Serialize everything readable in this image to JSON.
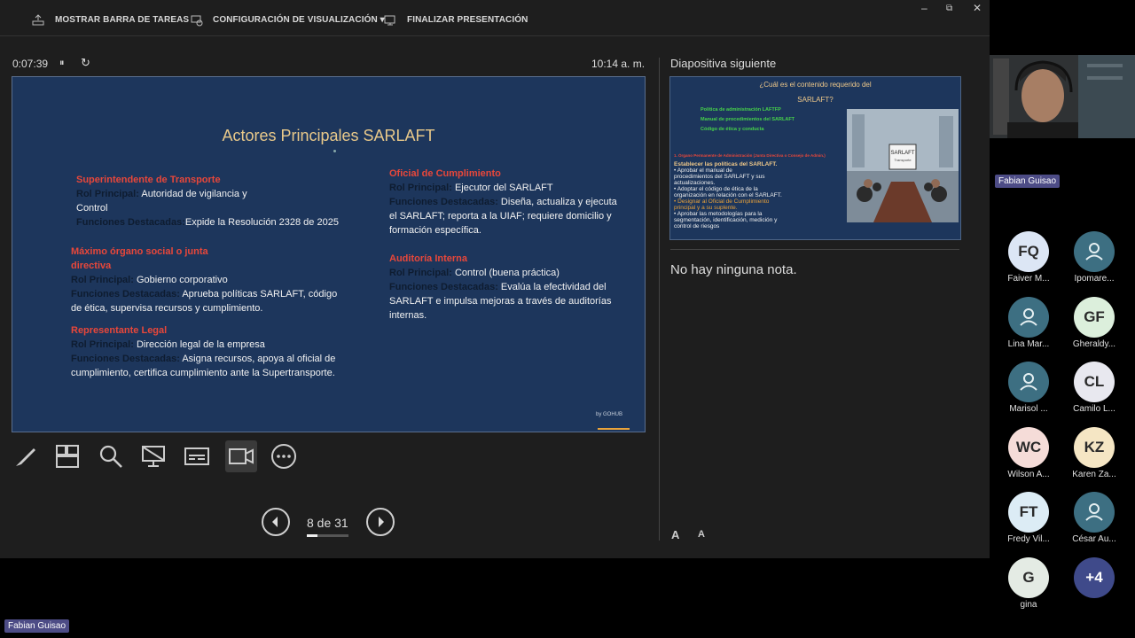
{
  "toolbar": {
    "show_taskbar": "MOSTRAR BARRA DE TAREAS",
    "display_settings": "CONFIGURACIÓN DE VISUALIZACIÓN ▾",
    "end_presentation": "FINALIZAR PRESENTACIÓN"
  },
  "window_controls": {
    "minimize": "–",
    "restore": "⧉",
    "close": "✕"
  },
  "timer": {
    "elapsed": "0:07:39",
    "pause": "⏸",
    "reset": "↻",
    "clock": "10:14 a. m."
  },
  "slide": {
    "title": "Actores Principales SARLAFT",
    "sections": [
      {
        "heading": "Superintendente de Transporte",
        "rol_label": "Rol Principal:",
        "rol_text_1": " Autoridad de vigilancia y",
        "rol_text_2": "Control",
        "fun_label": "Funciones Destacadas:",
        "fun_text_1": "Expide la Resolución 2328 de 2025"
      },
      {
        "heading_1": "Máximo órgano social o junta",
        "heading_2": "directiva",
        "rol_label": "Rol Principal:",
        "rol_text_1": " Gobierno corporativo",
        "fun_label": "Funciones Destacadas:",
        "fun_text_1": " Aprueba políticas SARLAFT, código",
        "fun_text_2": "de ética, supervisa recursos y cumplimiento."
      },
      {
        "heading": "Representante Legal",
        "rol_label": "Rol Principal:",
        "rol_text_1": " Dirección legal de la empresa",
        "fun_label": "Funciones Destacadas:",
        "fun_text_1": " Asigna recursos, apoya al oficial de",
        "fun_text_2": "cumplimiento, certifica cumplimiento ante la Supertransporte."
      },
      {
        "heading": "Oficial de Cumplimiento",
        "rol_label": "Rol Principal:",
        "rol_text_1": " Ejecutor del SARLAFT",
        "fun_label": "Funciones Destacadas:",
        "fun_text_1": " Diseña, actualiza y ejecuta",
        "fun_text_2": "el SARLAFT; reporta a la UIAF; requiere domicilio y",
        "fun_text_3": "formación específica."
      },
      {
        "heading": "Auditoría Interna",
        "rol_label": "Rol Principal:",
        "rol_text_1": " Control (buena práctica)",
        "fun_label": "Funciones Destacadas:",
        "fun_text_1": " Evalúa la efectividad del",
        "fun_text_2": "SARLAFT e impulsa mejoras a través de auditorías",
        "fun_text_3": "internas."
      }
    ],
    "logo": "by GOHUB"
  },
  "navigation": {
    "page": "8 de 31",
    "progress": 0.258
  },
  "next_slide": {
    "label": "Diapositiva siguiente",
    "title_1": "¿Cuál es el contenido requerido del",
    "title_2": "SARLAFT?",
    "bullets": [
      "Política de administración LAFTFP",
      "Manual de procedimientos del SARLAFT",
      "Código de ética y conducta"
    ],
    "org_heading": "1. Órgano Permanente de Administración (Junta Directiva o Consejo de Admin.)",
    "lines": [
      "Establecer las políticas del SARLAFT.",
      "• Aprobar el manual de",
      "procedimientos del SARLAFT y sus",
      "actualizaciones.",
      "• Adoptar el código de ética de la",
      "organización en relación con el SARLAFT.",
      "• Designar al Oficial de Cumplimiento",
      "principal y a su suplente.",
      "• Aprobar las metodologías para la",
      "segmentación, identificación, medición y",
      "control de riesgos"
    ],
    "image_sign": "SARLAFT",
    "image_sign_sub": "Transporte"
  },
  "notes": {
    "text": "No hay ninguna nota."
  },
  "font_controls": {
    "increase": "A",
    "decrease": "A"
  },
  "presenter_tag": "Fabian Guisao",
  "bottom_tag": "Fabian Guisao",
  "participants": [
    {
      "initials": "FQ",
      "name": "Faiver M...",
      "color": "#dce6f5"
    },
    {
      "initials": "",
      "name": "Ipomare...",
      "color": "#3d6f82",
      "icon": "person-icon"
    },
    {
      "initials": "",
      "name": "Lina Mar...",
      "color": "#3d6f82",
      "icon": "person-icon"
    },
    {
      "initials": "GF",
      "name": "Gheraldy...",
      "color": "#dcefdc"
    },
    {
      "initials": "",
      "name": "Marisol ...",
      "color": "#3d6f82",
      "icon": "person-icon"
    },
    {
      "initials": "CL",
      "name": "Camilo L...",
      "color": "#e8e8ef"
    },
    {
      "initials": "WC",
      "name": "Wilson A...",
      "color": "#f5dcd8"
    },
    {
      "initials": "KZ",
      "name": "Karen Za...",
      "color": "#f5e6c4"
    },
    {
      "initials": "FT",
      "name": "Fredy Vil...",
      "color": "#dcecf5"
    },
    {
      "initials": "",
      "name": "César Au...",
      "color": "#3d6f82",
      "icon": "person-icon"
    },
    {
      "initials": "G",
      "name": "gina",
      "color": "#e4ebe4"
    },
    {
      "initials": "+4",
      "name": "",
      "color": "#3f4a8a"
    }
  ]
}
